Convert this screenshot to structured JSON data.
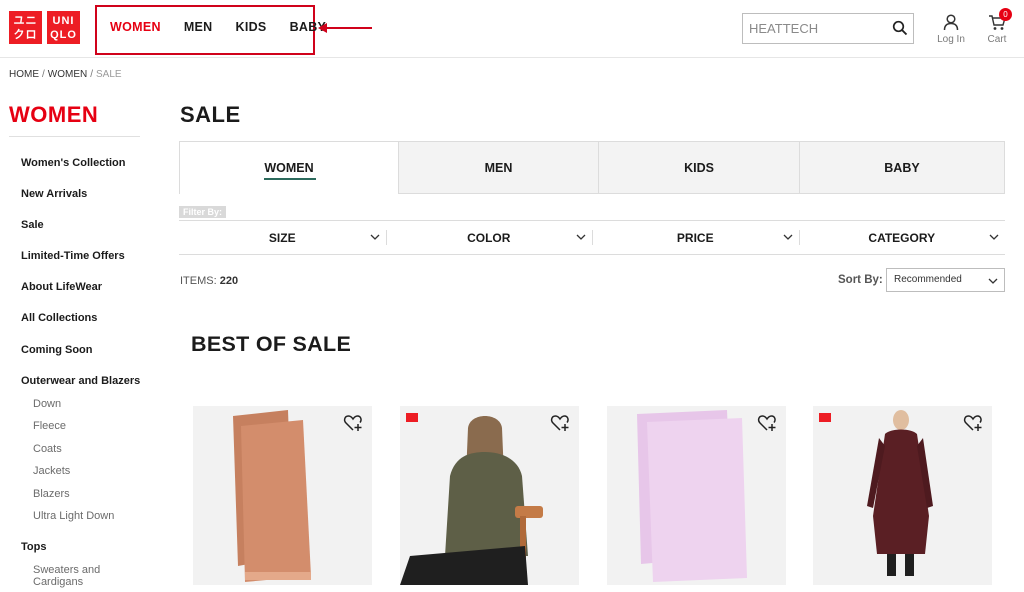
{
  "header": {
    "logo": {
      "top": "UNI",
      "bottom": "QLO",
      "left_top": "ユニ",
      "left_bottom": "クロ"
    },
    "nav": [
      "WOMEN",
      "MEN",
      "KIDS",
      "BABY"
    ],
    "search_placeholder": "HEATTECH",
    "login_label": "Log In",
    "cart_label": "Cart",
    "cart_count": "0"
  },
  "breadcrumb": {
    "home": "HOME",
    "parent": "WOMEN",
    "current": "SALE",
    "sep": "/"
  },
  "sidebar": {
    "title": "WOMEN",
    "items": [
      "Women's Collection",
      "New Arrivals",
      "Sale",
      "Limited-Time Offers",
      "About LifeWear",
      "All Collections",
      "Coming Soon",
      "Outerwear and Blazers"
    ],
    "outerwear_sub": [
      "Down",
      "Fleece",
      "Coats",
      "Jackets",
      "Blazers",
      "Ultra Light Down"
    ],
    "tops_label": "Tops",
    "tops_sub": [
      "Sweaters and",
      "Cardigans"
    ]
  },
  "main": {
    "title": "SALE",
    "tabs": [
      "WOMEN",
      "MEN",
      "KIDS",
      "BABY"
    ],
    "filter_by": "Filter By:",
    "filters": [
      "SIZE",
      "COLOR",
      "PRICE",
      "CATEGORY"
    ],
    "items_label": "ITEMS:",
    "items_count": "220",
    "sort_label": "Sort By:",
    "sort_value": "Recommended",
    "section_title": "BEST OF SALE"
  },
  "colors": {
    "brand_red": "#e60012",
    "annotation_red": "#d0021b",
    "tab_underline": "#2b6a5c"
  },
  "icons": [
    "search-icon",
    "user-icon",
    "cart-icon",
    "chevron-down-icon",
    "heart-plus-icon"
  ]
}
